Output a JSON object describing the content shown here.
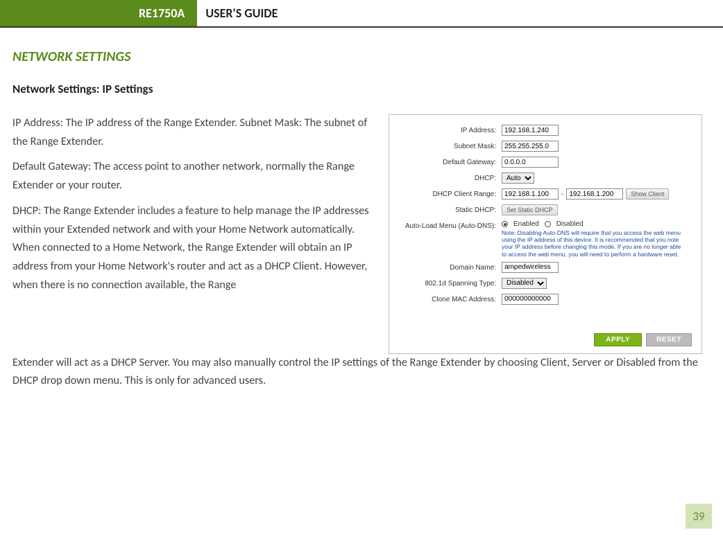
{
  "header": {
    "model": "RE1750A",
    "guide": "USER'S GUIDE"
  },
  "section": {
    "title": "NETWORK SETTINGS",
    "subtitle": "Network Settings: IP Settings"
  },
  "body": {
    "p1": "IP Address: The IP address of the Range Extender. Subnet Mask: The subnet of the Range Extender.",
    "p2": "Default Gateway: The access point to another network, normally the Range Extender or your router.",
    "p3a": "DHCP: The Range Extender includes a feature to help manage the IP addresses within your Extended network and with your Home Network automatically. When connected to a Home Network, the Range Extender will obtain an IP address from your Home Network's router and act as a DHCP Client. However, when there is no connection available, the Range",
    "p3b": "Extender will act as a DHCP Server. You may also manually control the IP settings of the Range Extender by choosing Client, Server or Disabled from the DHCP drop down menu. This is only for advanced users."
  },
  "figure": {
    "ip_label": "IP Address:",
    "ip_value": "192.168.1.240",
    "subnet_label": "Subnet Mask:",
    "subnet_value": "255.255.255.0",
    "gateway_label": "Default Gateway:",
    "gateway_value": "0.0.0.0",
    "dhcp_label": "DHCP:",
    "dhcp_value": "Auto",
    "range_label": "DHCP Client Range:",
    "range_start": "192.168.1.100",
    "range_sep": "-",
    "range_end": "192.168.1.200",
    "show_client": "Show Client",
    "static_dhcp_label": "Static DHCP:",
    "static_dhcp_btn": "Set Static DHCP",
    "autodns_label": "Auto-Load Menu (Auto-DNS):",
    "autodns_enabled": "Enabled",
    "autodns_disabled": "Disabled",
    "autodns_note": "Note: Disabling Auto-DNS will require that you access the web menu using the IP address of this device. It is recommended that you note your IP address before changing this mode. If you are no longer able to access the web menu, you will need to perform a hardware reset.",
    "domain_label": "Domain Name:",
    "domain_value": "ampedwireless",
    "spanning_label": "802.1d Spanning Type:",
    "spanning_value": "Disabled",
    "clone_label": "Clone MAC Address:",
    "clone_value": "000000000000",
    "apply": "APPLY",
    "reset": "RESET"
  },
  "page_number": "39"
}
